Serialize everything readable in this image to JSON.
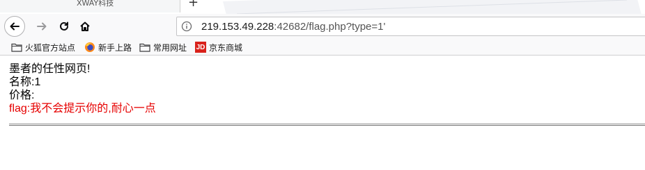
{
  "tab": {
    "title": "XWAY科技",
    "new_tab": "+"
  },
  "urlbar": {
    "host": "219.153.49.228",
    "rest": ":42682/flag.php?type=1'"
  },
  "bookmarks": [
    {
      "label": "火狐官方站点",
      "icon": "folder-icon"
    },
    {
      "label": "新手上路",
      "icon": "firefox-icon"
    },
    {
      "label": "常用网址",
      "icon": "folder-icon"
    },
    {
      "label": "京东商城",
      "icon": "jd-icon",
      "icon_text": "JD"
    }
  ],
  "page": {
    "heading": "墨者的任性网页!",
    "name_line": "名称:1",
    "price_line": "价格:",
    "flag_line": "flag:我不会提示你的,耐心一点"
  },
  "colors": {
    "flag_text": "#e60000",
    "jd_red": "#d9221b"
  }
}
